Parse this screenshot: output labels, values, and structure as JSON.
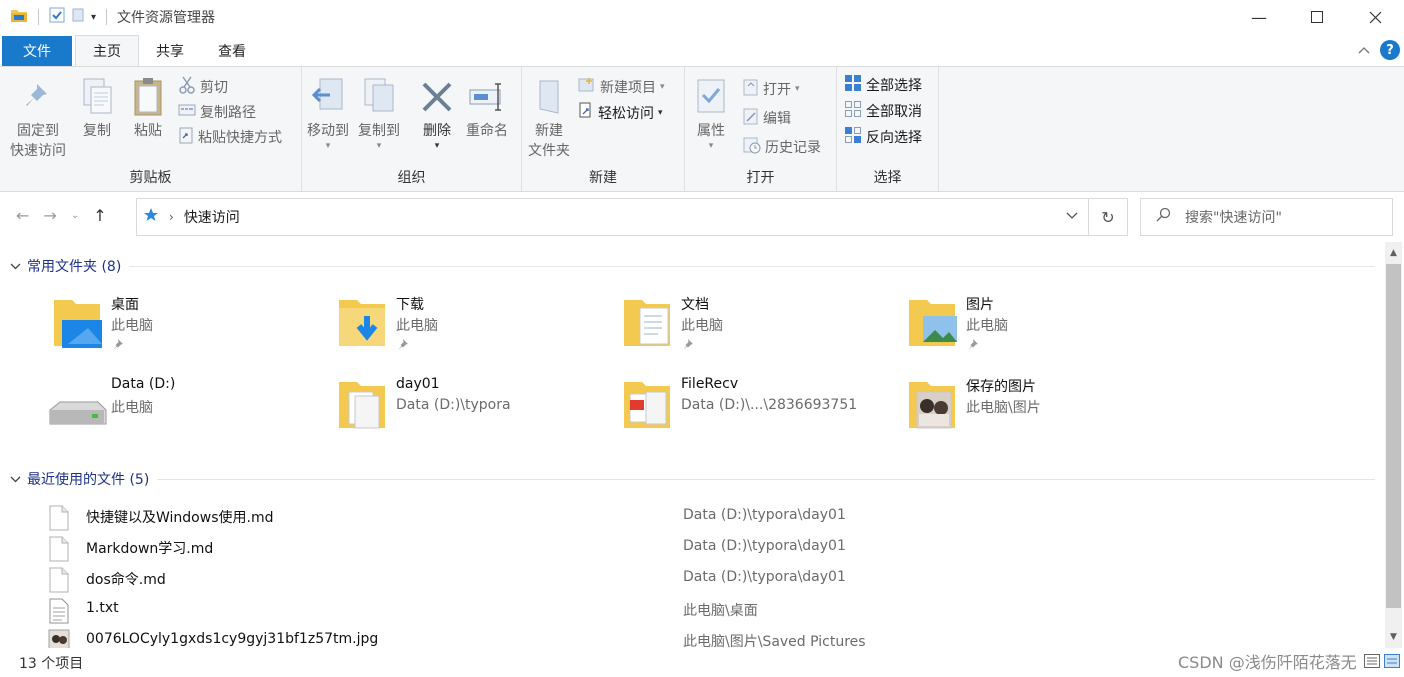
{
  "window": {
    "title": "文件资源管理器",
    "minimize_icon": "minimize-icon",
    "maximize_icon": "maximize-icon",
    "close_icon": "close-icon"
  },
  "ribbon_tabs": [
    "文件",
    "主页",
    "共享",
    "查看"
  ],
  "ribbon": {
    "clipboard": {
      "label": "剪贴板",
      "pin_line1": "固定到",
      "pin_line2": "快速访问",
      "copy": "复制",
      "paste": "粘贴",
      "cut": "剪切",
      "copy_path": "复制路径",
      "paste_shortcut": "粘贴快捷方式"
    },
    "organize": {
      "label": "组织",
      "move_to": "移动到",
      "copy_to": "复制到",
      "delete": "删除",
      "rename": "重命名"
    },
    "new": {
      "label": "新建",
      "new_folder_line1": "新建",
      "new_folder_line2": "文件夹",
      "new_item": "新建项目",
      "easy_access": "轻松访问"
    },
    "open": {
      "label": "打开",
      "properties": "属性",
      "open": "打开",
      "edit": "编辑",
      "history": "历史记录"
    },
    "select": {
      "label": "选择",
      "select_all": "全部选择",
      "select_none": "全部取消",
      "invert": "反向选择"
    }
  },
  "address": {
    "path": "快速访问",
    "search_placeholder": "搜索\"快速访问\""
  },
  "frequent": {
    "header": "常用文件夹 (8)",
    "items": [
      {
        "name": "桌面",
        "sub": "此电脑"
      },
      {
        "name": "下载",
        "sub": "此电脑"
      },
      {
        "name": "文档",
        "sub": "此电脑"
      },
      {
        "name": "图片",
        "sub": "此电脑"
      },
      {
        "name": "Data (D:)",
        "sub": "此电脑"
      },
      {
        "name": "day01",
        "sub": "Data (D:)\\typora"
      },
      {
        "name": "FileRecv",
        "sub": "Data (D:)\\...\\2836693751"
      },
      {
        "name": "保存的图片",
        "sub": "此电脑\\图片"
      }
    ]
  },
  "recent": {
    "header": "最近使用的文件 (5)",
    "items": [
      {
        "name": "快捷键以及Windows使用.md",
        "location": "Data (D:)\\typora\\day01"
      },
      {
        "name": "Markdown学习.md",
        "location": "Data (D:)\\typora\\day01"
      },
      {
        "name": "dos命令.md",
        "location": "Data (D:)\\typora\\day01"
      },
      {
        "name": "1.txt",
        "location": "此电脑\\桌面"
      },
      {
        "name": "0076LOCyly1gxds1cy9gyj31bf1z57tm.jpg",
        "location": "此电脑\\图片\\Saved Pictures"
      }
    ]
  },
  "status": {
    "count": "13 个项目",
    "watermark": "CSDN @浅伤阡陌花落无"
  },
  "colors": {
    "accent": "#1979ca",
    "folder": "#f3c94f",
    "section_header": "#1e3287"
  }
}
